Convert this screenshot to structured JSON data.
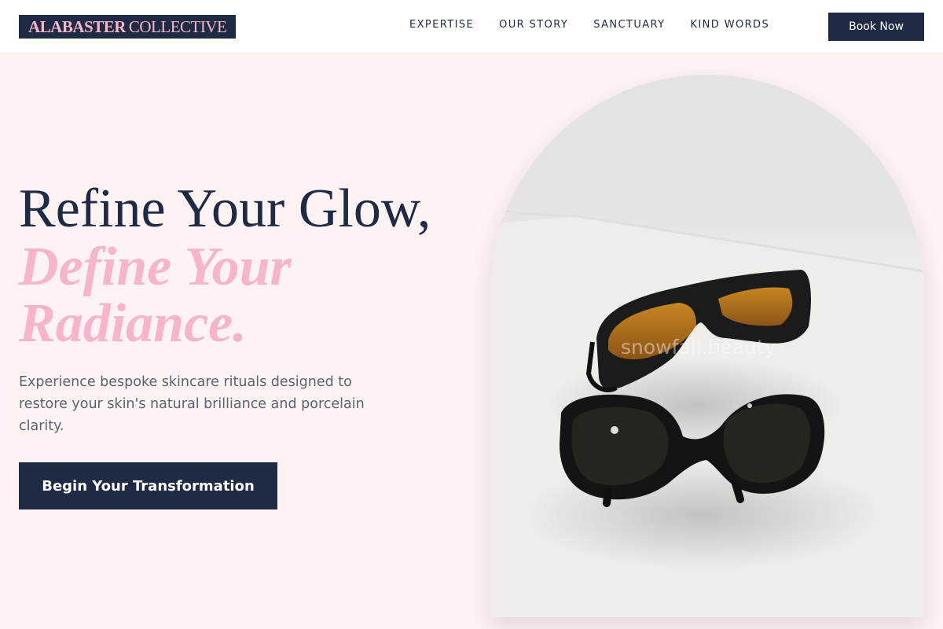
{
  "brand": {
    "part1": "ALABASTER",
    "part2": "COLLECTIVE"
  },
  "nav": {
    "items": [
      {
        "label": "EXPERTISE"
      },
      {
        "label": "OUR STORY"
      },
      {
        "label": "SANCTUARY"
      },
      {
        "label": "KIND WORDS"
      }
    ],
    "book_label": "Book Now"
  },
  "hero": {
    "headline": "Refine Your Glow,",
    "headline_accent": "Define Your Radiance.",
    "description": "Experience bespoke skincare rituals designed to restore your skin's natural brilliance and porcelain clarity.",
    "cta_label": "Begin Your Transformation",
    "image": {
      "icon": "safety-glasses-photo",
      "watermark": "snowfall.beauty"
    }
  },
  "colors": {
    "navy": "#1f2a44",
    "pink": "#f7b6c8",
    "background": "#fdf3f3",
    "muted_text": "#5b6274"
  }
}
